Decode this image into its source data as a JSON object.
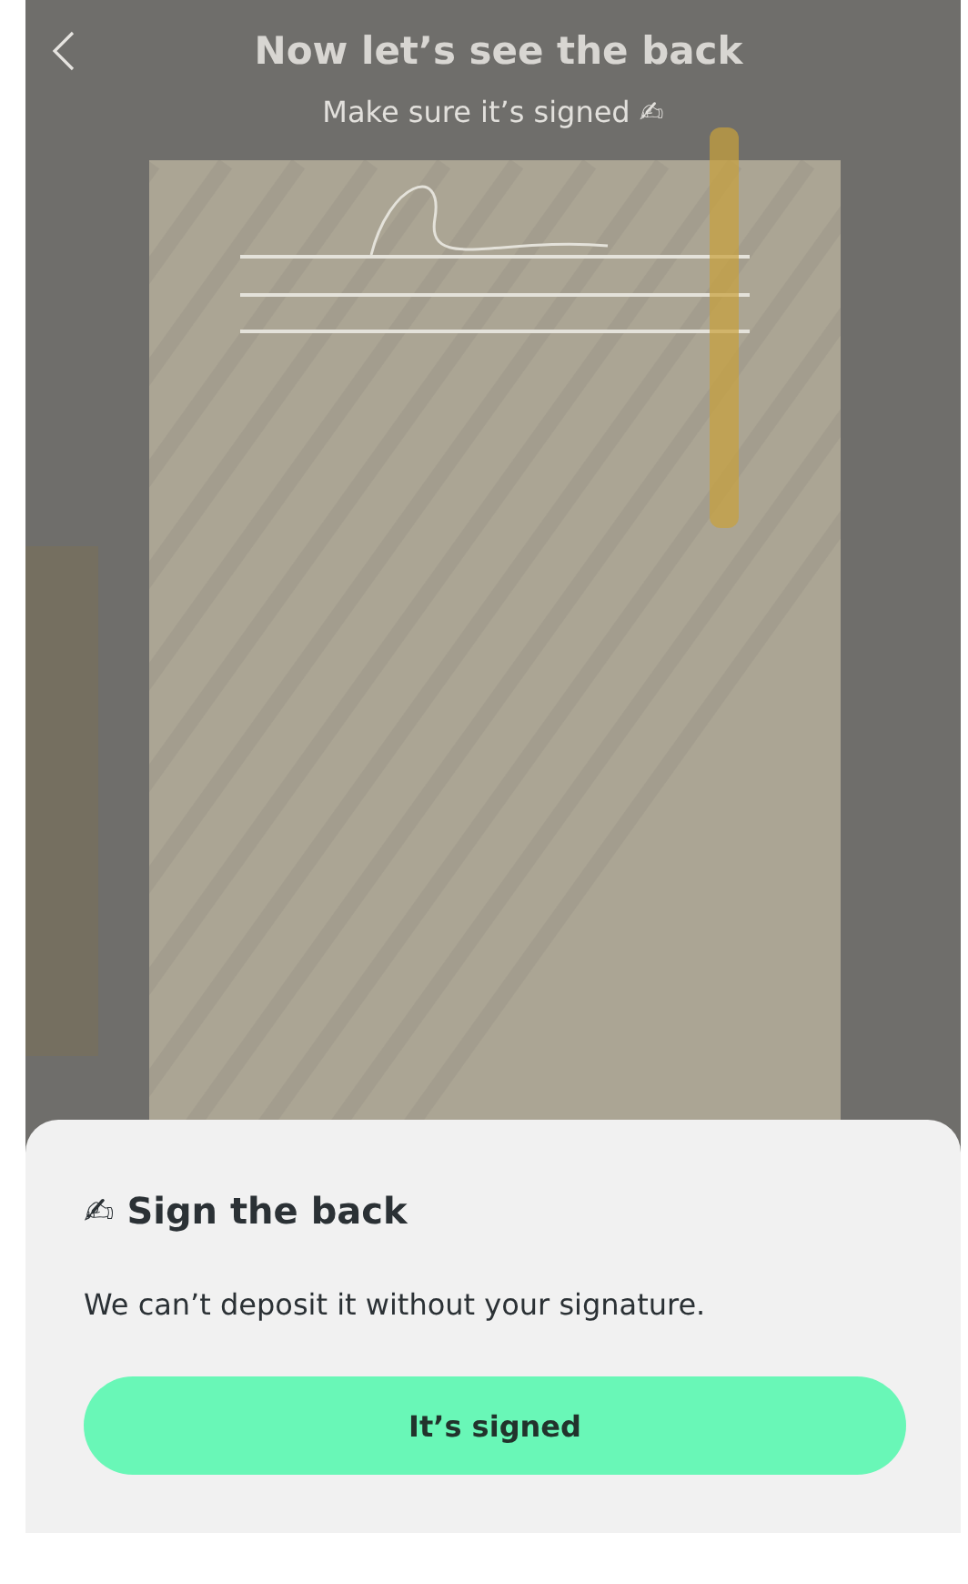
{
  "header": {
    "title": "Now let’s see the back",
    "subtitle": "Make sure it’s signed ✍"
  },
  "sheet": {
    "title": "✍ Sign the back",
    "message": "We can’t deposit it without your signature.",
    "button": "It’s signed"
  }
}
